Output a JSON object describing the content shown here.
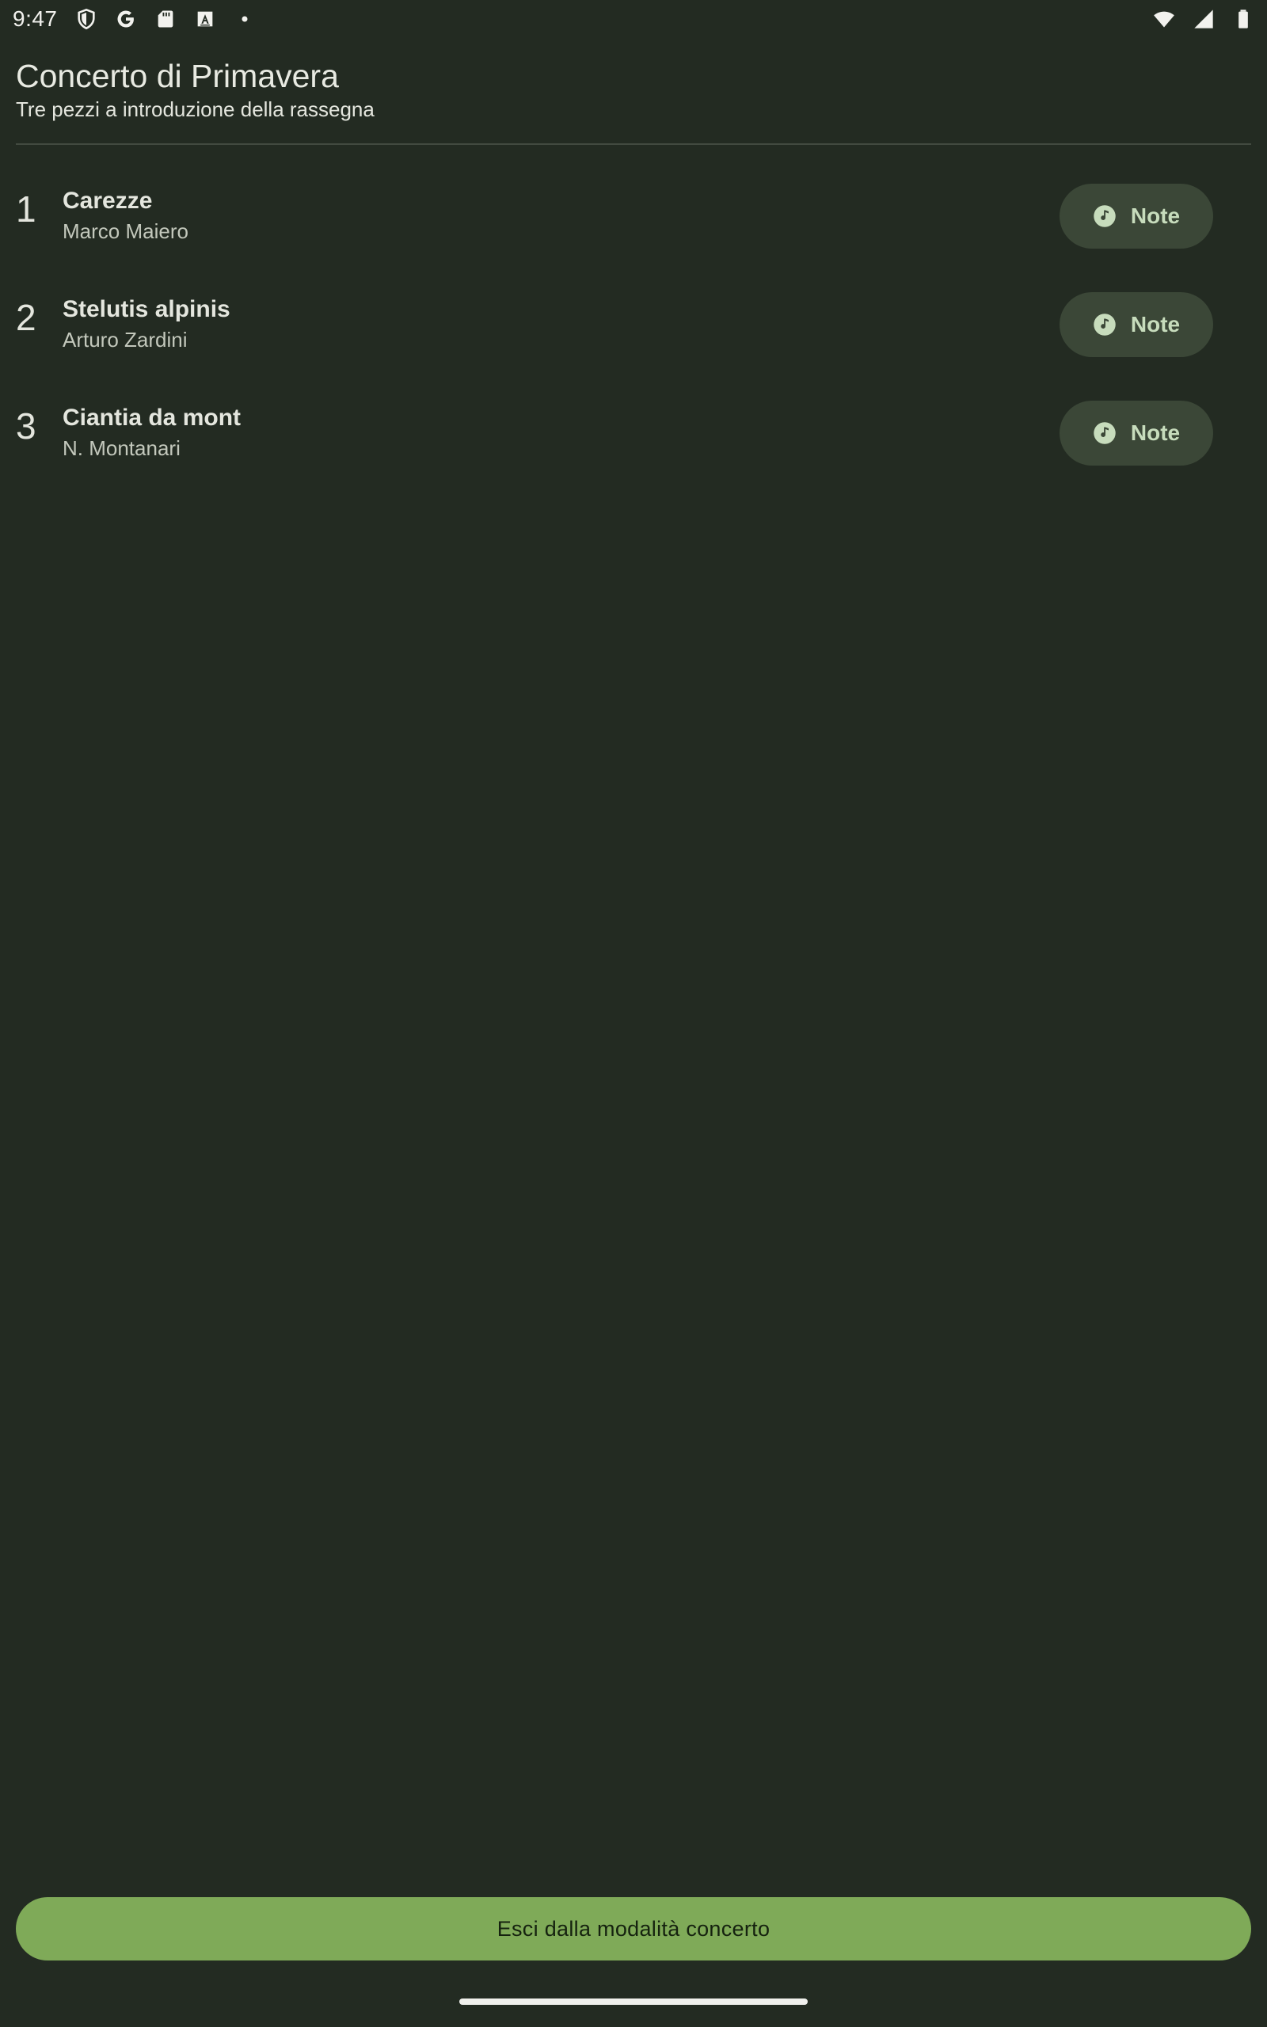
{
  "status_bar": {
    "time": "9:47",
    "left_icons": [
      "shield-icon",
      "google-icon",
      "sd-card-icon",
      "font-a-icon",
      "dot-icon"
    ],
    "right_icons": [
      "wifi-icon",
      "signal-icon",
      "battery-icon"
    ]
  },
  "header": {
    "title": "Concerto di Primavera",
    "subtitle": "Tre pezzi a introduzione della rassegna"
  },
  "pieces": [
    {
      "number": "1",
      "title": "Carezze",
      "composer": "Marco Maiero",
      "button_label": "Note",
      "button_icon": "music-note-icon"
    },
    {
      "number": "2",
      "title": "Stelutis alpinis",
      "composer": "Arturo Zardini",
      "button_label": "Note",
      "button_icon": "music-note-icon"
    },
    {
      "number": "3",
      "title": "Ciantia da mont",
      "composer": "N. Montanari",
      "button_label": "Note",
      "button_icon": "music-note-icon"
    }
  ],
  "footer": {
    "exit_label": "Esci dalla modalità concerto"
  },
  "colors": {
    "background": "#232b22",
    "note_button_bg": "#3b4737",
    "note_button_text": "#c7dcbc",
    "exit_button_bg": "#7faa58",
    "exit_button_text": "#15220f"
  }
}
